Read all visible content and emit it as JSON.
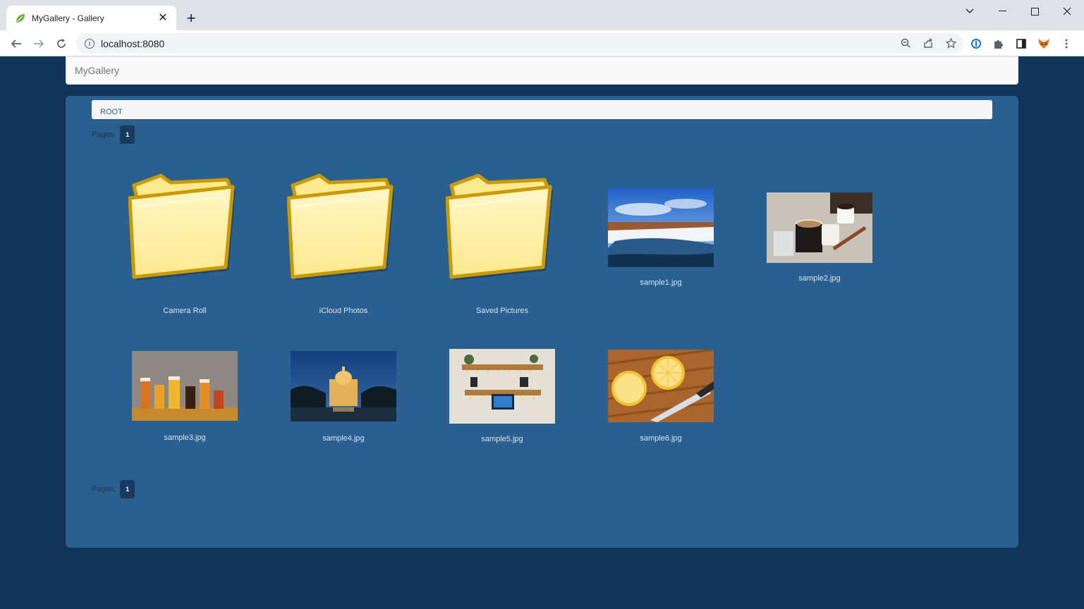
{
  "browser": {
    "tab_title": "MyGallery - Gallery",
    "url": "localhost:8080"
  },
  "app": {
    "brand": "MyGallery"
  },
  "breadcrumb": {
    "root": "ROOT"
  },
  "pager": {
    "label": "Pages:",
    "current_page": "1"
  },
  "items": [
    {
      "name": "Camera Roll",
      "kind": "folder"
    },
    {
      "name": "iCloud Photos",
      "kind": "folder"
    },
    {
      "name": "Saved Pictures",
      "kind": "folder"
    },
    {
      "name": "sample1.jpg",
      "kind": "image",
      "subject": "winter river landscape"
    },
    {
      "name": "sample2.jpg",
      "kind": "image",
      "subject": "coffee cups"
    },
    {
      "name": "sample3.jpg",
      "kind": "image",
      "subject": "beer glasses"
    },
    {
      "name": "sample4.jpg",
      "kind": "image",
      "subject": "cathedral at night"
    },
    {
      "name": "sample5.jpg",
      "kind": "image",
      "subject": "desk setup with lights"
    },
    {
      "name": "sample6.jpg",
      "kind": "image",
      "subject": "sliced lemons"
    }
  ],
  "icons": [
    "leaf-favicon-icon",
    "close-icon",
    "plus-icon",
    "back-arrow-icon",
    "forward-arrow-icon",
    "reload-icon",
    "info-icon",
    "zoom-icon",
    "share-icon",
    "star-icon",
    "password-manager-icon",
    "puzzle-icon",
    "sidebar-icon",
    "fox-extension-icon",
    "kebab-menu-icon",
    "folder-icon"
  ],
  "colors": {
    "page_bg": "#11345a",
    "panel_bg": "#2a6090",
    "pager_btn": "#173a5e",
    "folder_fill": "#fde98e",
    "folder_stroke": "#c99a06"
  }
}
